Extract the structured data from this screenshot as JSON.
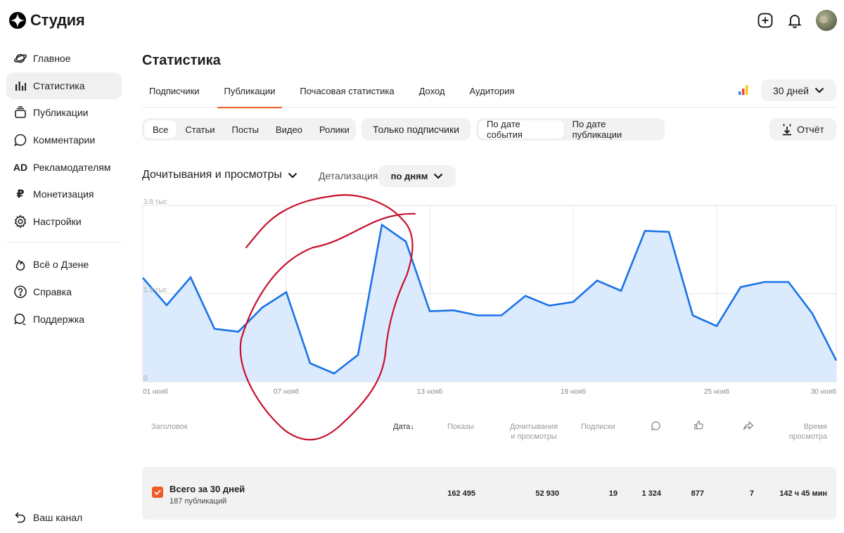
{
  "app": {
    "name": "Студия"
  },
  "sidebar": {
    "items": [
      {
        "label": "Главное",
        "icon": "planet-icon"
      },
      {
        "label": "Статистика",
        "icon": "stats-bars-icon",
        "active": true
      },
      {
        "label": "Публикации",
        "icon": "publications-icon"
      },
      {
        "label": "Комментарии",
        "icon": "comment-icon"
      },
      {
        "label": "Рекламодателям",
        "icon": "ad-icon"
      },
      {
        "label": "Монетизация",
        "icon": "ruble-icon"
      },
      {
        "label": "Настройки",
        "icon": "gear-icon"
      }
    ],
    "secondary": [
      {
        "label": "Всё о Дзене",
        "icon": "flame-icon"
      },
      {
        "label": "Справка",
        "icon": "help-icon"
      },
      {
        "label": "Поддержка",
        "icon": "support-chat-icon"
      }
    ],
    "bottom": {
      "label": "Ваш канал",
      "icon": "back-arrow-icon"
    }
  },
  "header": {
    "title": "Статистика",
    "tabs": [
      "Подписчики",
      "Публикации",
      "Почасовая статистика",
      "Доход",
      "Аудитория"
    ],
    "active_tab": "Публикации",
    "period": "30 дней"
  },
  "filters": {
    "type": [
      "Все",
      "Статьи",
      "Посты",
      "Видео",
      "Ролики"
    ],
    "subscribers_only": "Только подписчики",
    "date_mode": [
      "По дате события",
      "По дате публикации"
    ],
    "report": "Отчёт"
  },
  "metric": {
    "selected": "Дочитывания и просмотры",
    "detail_label": "Детализация",
    "detail_value": "по дням"
  },
  "chart_data": {
    "type": "area",
    "x": [
      "01 нояб",
      "02 нояб",
      "03 нояб",
      "04 нояб",
      "05 нояб",
      "06 нояб",
      "07 нояб",
      "08 нояб",
      "09 нояб",
      "10 нояб",
      "11 нояб",
      "12 нояб",
      "13 нояб",
      "14 нояб",
      "15 нояб",
      "16 нояб",
      "17 нояб",
      "18 нояб",
      "19 нояб",
      "20 нояб",
      "21 нояб",
      "22 нояб",
      "23 нояб",
      "24 нояб",
      "25 нояб",
      "26 нояб",
      "27 нояб",
      "28 нояб",
      "29 нояб",
      "30 нояб"
    ],
    "xticks": [
      "01 нояб",
      "07 нояб",
      "13 нояб",
      "19 нояб",
      "25 нояб",
      "30 нояб"
    ],
    "yticks": [
      "0",
      "1.9 тыс",
      "3.8 тыс"
    ],
    "ylim": [
      0,
      3800
    ],
    "values": [
      2240,
      1650,
      2250,
      1140,
      1080,
      1600,
      1930,
      400,
      180,
      580,
      3380,
      3020,
      1520,
      1540,
      1430,
      1430,
      1850,
      1640,
      1720,
      2180,
      1960,
      3250,
      3230,
      1430,
      1200,
      2040,
      2150,
      2150,
      1470,
      460
    ],
    "line_color": "#1a73e8",
    "fill_color": "#dbeafc",
    "annotation_color": "#c8102e"
  },
  "table": {
    "headers": {
      "title": "Заголовок",
      "date": "Дата",
      "shows": "Показы",
      "reads": [
        "Дочитывания",
        "и просмотры"
      ],
      "subs": "Подписки",
      "time": [
        "Время",
        "просмотра"
      ]
    },
    "total": {
      "title": "Всего за 30 дней",
      "subtitle": "187 публикаций",
      "shows": "162 495",
      "reads": "52 930",
      "subs": "19",
      "comments": "1 324",
      "likes": "877",
      "shares": "7",
      "time": "142 ч 45 мин"
    }
  }
}
